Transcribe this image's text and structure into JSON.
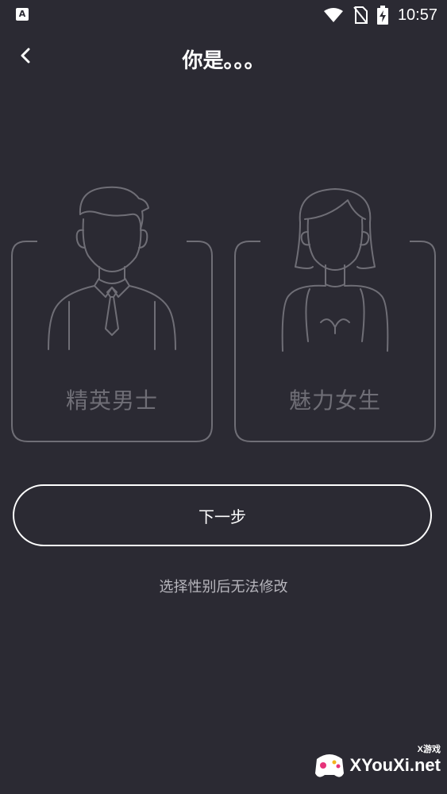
{
  "status_bar": {
    "app_icon": "A",
    "time": "10:57",
    "icons": [
      "wifi-icon",
      "no-sim-icon",
      "battery-charging-icon"
    ]
  },
  "header": {
    "back_icon": "chevron-left-icon",
    "title": "你是。。。"
  },
  "cards": {
    "male": {
      "label": "精英男士",
      "icon": "businessman-icon"
    },
    "female": {
      "label": "魅力女生",
      "icon": "woman-icon"
    }
  },
  "next_button": {
    "label": "下一步"
  },
  "hint": "选择性别后无法修改",
  "watermark": {
    "brand": "XYouXi.net",
    "small": "X游戏"
  },
  "colors": {
    "background": "#2b2a33",
    "outline": "#6f6e76",
    "text": "#ffffff",
    "hint": "#b7b6bd"
  }
}
